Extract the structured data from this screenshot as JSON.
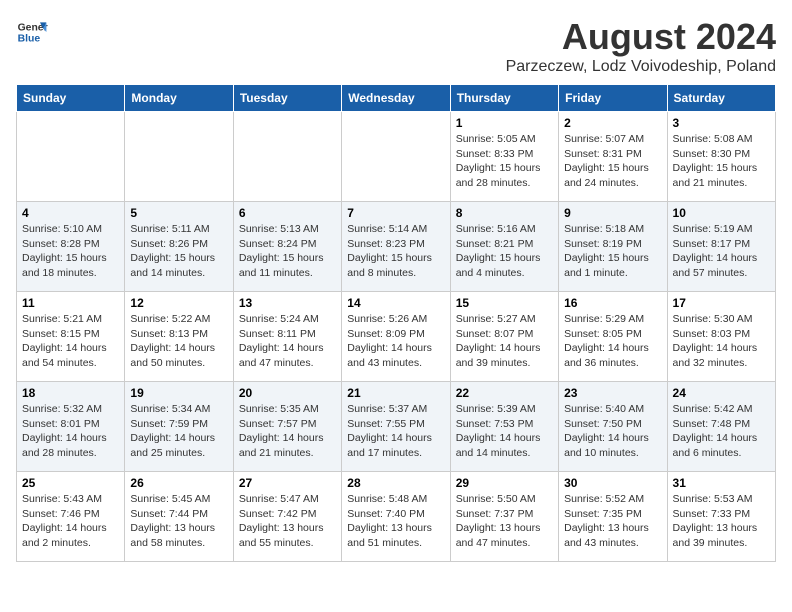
{
  "header": {
    "logo_line1": "General",
    "logo_line2": "Blue",
    "month_year": "August 2024",
    "location": "Parzeczew, Lodz Voivodeship, Poland"
  },
  "weekdays": [
    "Sunday",
    "Monday",
    "Tuesday",
    "Wednesday",
    "Thursday",
    "Friday",
    "Saturday"
  ],
  "weeks": [
    [
      {
        "day": "",
        "info": ""
      },
      {
        "day": "",
        "info": ""
      },
      {
        "day": "",
        "info": ""
      },
      {
        "day": "",
        "info": ""
      },
      {
        "day": "1",
        "info": "Sunrise: 5:05 AM\nSunset: 8:33 PM\nDaylight: 15 hours\nand 28 minutes."
      },
      {
        "day": "2",
        "info": "Sunrise: 5:07 AM\nSunset: 8:31 PM\nDaylight: 15 hours\nand 24 minutes."
      },
      {
        "day": "3",
        "info": "Sunrise: 5:08 AM\nSunset: 8:30 PM\nDaylight: 15 hours\nand 21 minutes."
      }
    ],
    [
      {
        "day": "4",
        "info": "Sunrise: 5:10 AM\nSunset: 8:28 PM\nDaylight: 15 hours\nand 18 minutes."
      },
      {
        "day": "5",
        "info": "Sunrise: 5:11 AM\nSunset: 8:26 PM\nDaylight: 15 hours\nand 14 minutes."
      },
      {
        "day": "6",
        "info": "Sunrise: 5:13 AM\nSunset: 8:24 PM\nDaylight: 15 hours\nand 11 minutes."
      },
      {
        "day": "7",
        "info": "Sunrise: 5:14 AM\nSunset: 8:23 PM\nDaylight: 15 hours\nand 8 minutes."
      },
      {
        "day": "8",
        "info": "Sunrise: 5:16 AM\nSunset: 8:21 PM\nDaylight: 15 hours\nand 4 minutes."
      },
      {
        "day": "9",
        "info": "Sunrise: 5:18 AM\nSunset: 8:19 PM\nDaylight: 15 hours\nand 1 minute."
      },
      {
        "day": "10",
        "info": "Sunrise: 5:19 AM\nSunset: 8:17 PM\nDaylight: 14 hours\nand 57 minutes."
      }
    ],
    [
      {
        "day": "11",
        "info": "Sunrise: 5:21 AM\nSunset: 8:15 PM\nDaylight: 14 hours\nand 54 minutes."
      },
      {
        "day": "12",
        "info": "Sunrise: 5:22 AM\nSunset: 8:13 PM\nDaylight: 14 hours\nand 50 minutes."
      },
      {
        "day": "13",
        "info": "Sunrise: 5:24 AM\nSunset: 8:11 PM\nDaylight: 14 hours\nand 47 minutes."
      },
      {
        "day": "14",
        "info": "Sunrise: 5:26 AM\nSunset: 8:09 PM\nDaylight: 14 hours\nand 43 minutes."
      },
      {
        "day": "15",
        "info": "Sunrise: 5:27 AM\nSunset: 8:07 PM\nDaylight: 14 hours\nand 39 minutes."
      },
      {
        "day": "16",
        "info": "Sunrise: 5:29 AM\nSunset: 8:05 PM\nDaylight: 14 hours\nand 36 minutes."
      },
      {
        "day": "17",
        "info": "Sunrise: 5:30 AM\nSunset: 8:03 PM\nDaylight: 14 hours\nand 32 minutes."
      }
    ],
    [
      {
        "day": "18",
        "info": "Sunrise: 5:32 AM\nSunset: 8:01 PM\nDaylight: 14 hours\nand 28 minutes."
      },
      {
        "day": "19",
        "info": "Sunrise: 5:34 AM\nSunset: 7:59 PM\nDaylight: 14 hours\nand 25 minutes."
      },
      {
        "day": "20",
        "info": "Sunrise: 5:35 AM\nSunset: 7:57 PM\nDaylight: 14 hours\nand 21 minutes."
      },
      {
        "day": "21",
        "info": "Sunrise: 5:37 AM\nSunset: 7:55 PM\nDaylight: 14 hours\nand 17 minutes."
      },
      {
        "day": "22",
        "info": "Sunrise: 5:39 AM\nSunset: 7:53 PM\nDaylight: 14 hours\nand 14 minutes."
      },
      {
        "day": "23",
        "info": "Sunrise: 5:40 AM\nSunset: 7:50 PM\nDaylight: 14 hours\nand 10 minutes."
      },
      {
        "day": "24",
        "info": "Sunrise: 5:42 AM\nSunset: 7:48 PM\nDaylight: 14 hours\nand 6 minutes."
      }
    ],
    [
      {
        "day": "25",
        "info": "Sunrise: 5:43 AM\nSunset: 7:46 PM\nDaylight: 14 hours\nand 2 minutes."
      },
      {
        "day": "26",
        "info": "Sunrise: 5:45 AM\nSunset: 7:44 PM\nDaylight: 13 hours\nand 58 minutes."
      },
      {
        "day": "27",
        "info": "Sunrise: 5:47 AM\nSunset: 7:42 PM\nDaylight: 13 hours\nand 55 minutes."
      },
      {
        "day": "28",
        "info": "Sunrise: 5:48 AM\nSunset: 7:40 PM\nDaylight: 13 hours\nand 51 minutes."
      },
      {
        "day": "29",
        "info": "Sunrise: 5:50 AM\nSunset: 7:37 PM\nDaylight: 13 hours\nand 47 minutes."
      },
      {
        "day": "30",
        "info": "Sunrise: 5:52 AM\nSunset: 7:35 PM\nDaylight: 13 hours\nand 43 minutes."
      },
      {
        "day": "31",
        "info": "Sunrise: 5:53 AM\nSunset: 7:33 PM\nDaylight: 13 hours\nand 39 minutes."
      }
    ]
  ]
}
